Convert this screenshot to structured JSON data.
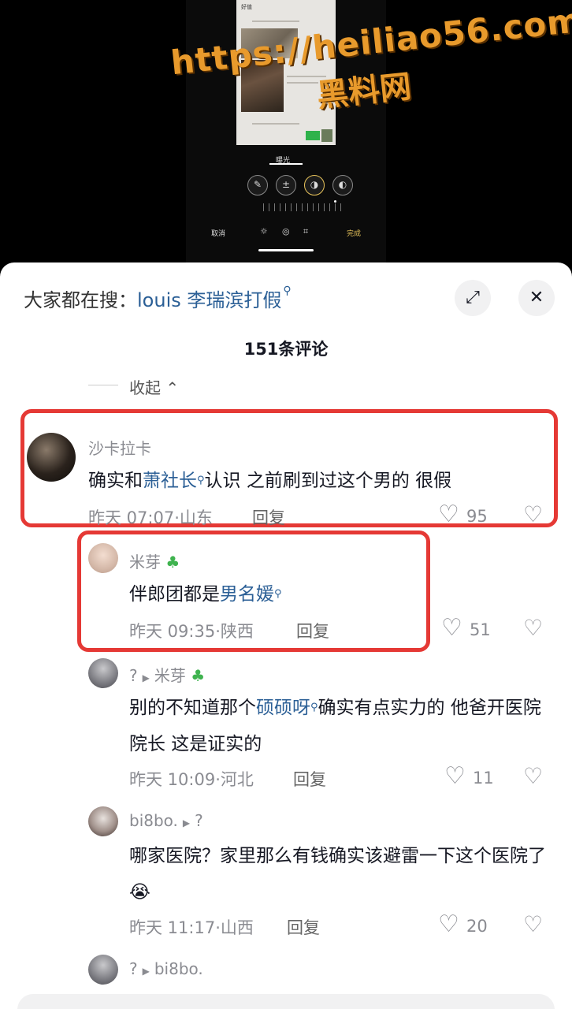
{
  "editor": {
    "photo_header": "好值",
    "tab_label": "曝光",
    "cancel_label": "取消",
    "done_label": "完成",
    "tool_icons": [
      "magic-wand-icon",
      "exposure-icon",
      "contrast-icon",
      "brightness-icon"
    ]
  },
  "watermark": {
    "url": "https://heiliao56.com",
    "text": "黑料网"
  },
  "header": {
    "search_prefix": "大家都在搜：",
    "search_keyword": "louis 李瑞滨打假",
    "search_icon": "search-icon",
    "comment_count": "151条评论",
    "collapse_label": "收起"
  },
  "comments": [
    {
      "user": "沙卡拉卡",
      "text_before": "确实和",
      "keyword": "萧社长",
      "text_after": "认识 之前刷到过这个男的 很假",
      "time": "昨天 07:07",
      "location": "山东",
      "reply": "回复",
      "likes": "95"
    },
    {
      "user": "米芽",
      "text_before": "伴郎团都是",
      "keyword": "男名媛",
      "text_after": "",
      "time": "昨天 09:35",
      "location": "陕西",
      "reply": "回复",
      "likes": "51"
    },
    {
      "user": "?",
      "reply_to": "米芽",
      "text_before": "别的不知道那个",
      "keyword": "硕硕呀",
      "text_after": "确实有点实力的 他爸开医院院长 这是证实的",
      "time": "昨天 10:09",
      "location": "河北",
      "reply": "回复",
      "likes": "11"
    },
    {
      "user": "bi8bo.",
      "reply_to": "?",
      "text": "哪家医院？家里那么有钱确实该避雷一下这个医院了😭",
      "time": "昨天 11:17",
      "location": "山西",
      "reply": "回复",
      "likes": "20"
    },
    {
      "user": "?",
      "reply_to": "bi8bo."
    }
  ]
}
